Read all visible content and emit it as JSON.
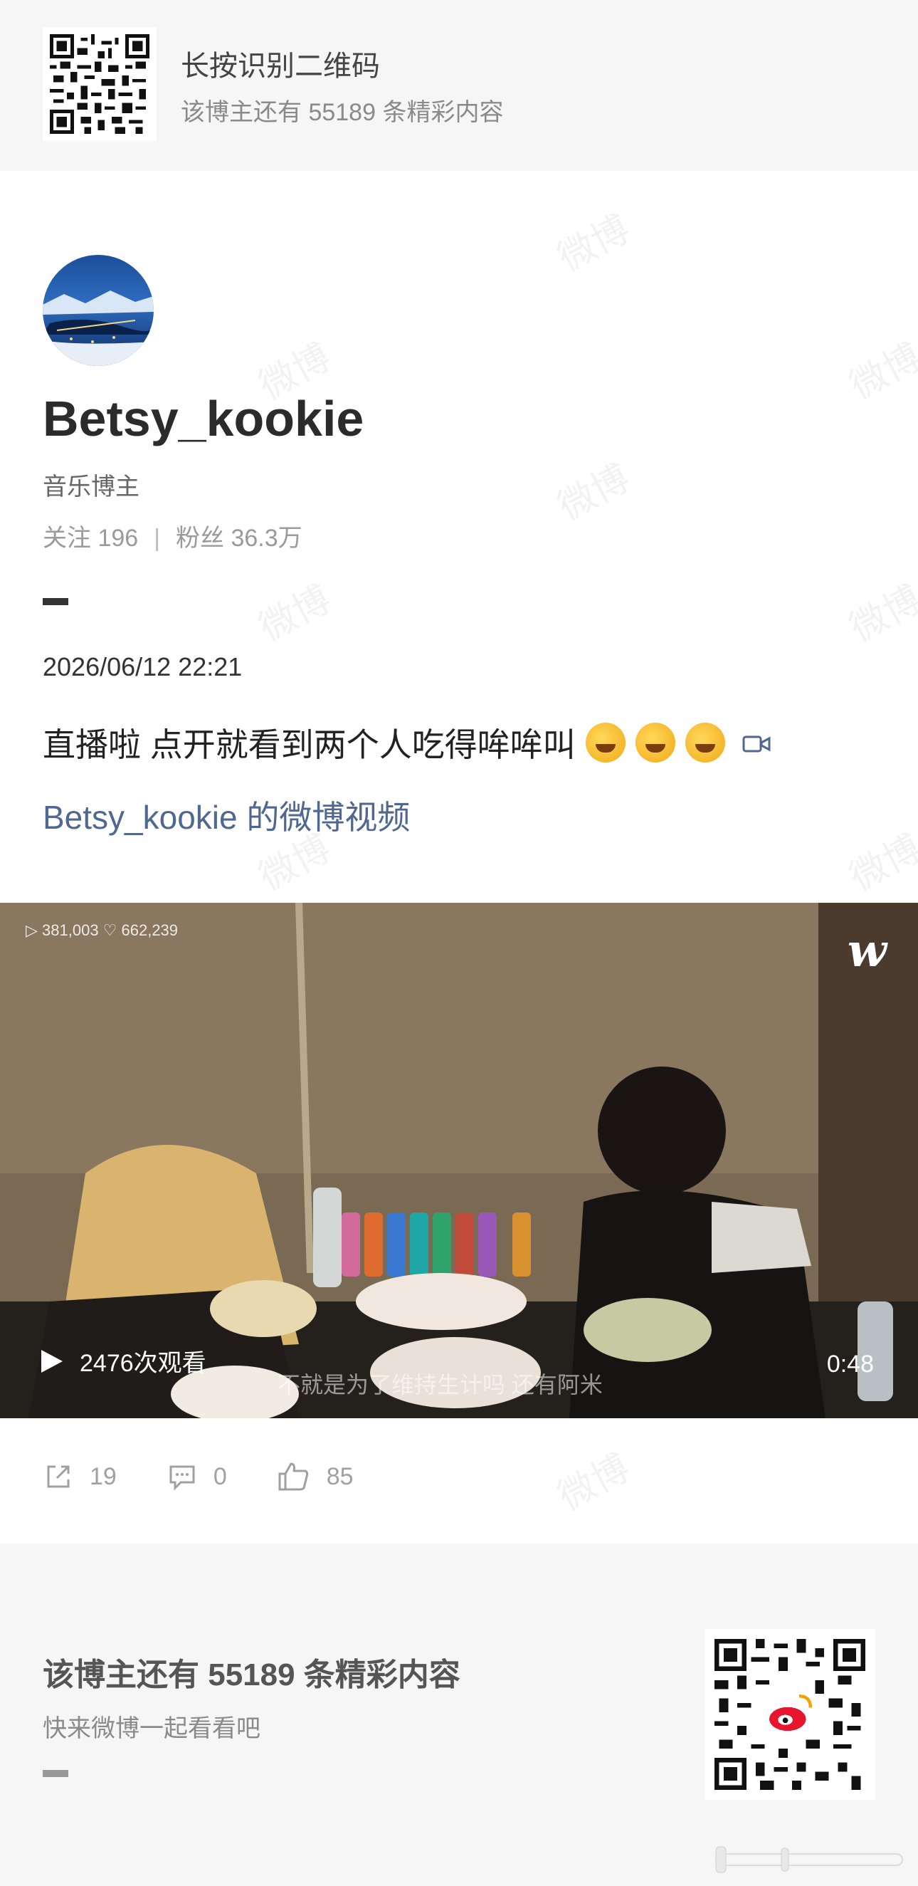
{
  "top_banner": {
    "title": "长按识别二维码",
    "subtitle": "该博主还有 55189 条精彩内容"
  },
  "profile": {
    "username": "Betsy_kookie",
    "tag": "音乐博主",
    "following_label": "关注 196",
    "followers_label": "粉丝 36.3万",
    "separator": "|"
  },
  "post": {
    "time": "2026/06/12 22:21",
    "text": "直播啦 点开就看到两个人吃得哞哞叫",
    "link": "Betsy_kookie 的微博视频"
  },
  "video": {
    "stats": "▷ 381,003  ♡ 662,239",
    "logo": "w",
    "views": "2476次观看",
    "duration": "0:48",
    "caption": "不就是为了维持生计吗 还有阿米"
  },
  "actions": {
    "reposts": "19",
    "comments": "0",
    "likes": "85"
  },
  "footer": {
    "title": "该博主还有 55189 条精彩内容",
    "subtitle": "快来微博一起看看吧"
  },
  "watermark_text": "微博",
  "colors": {
    "link": "#50678f",
    "banner_bg": "#f6f6f6"
  }
}
